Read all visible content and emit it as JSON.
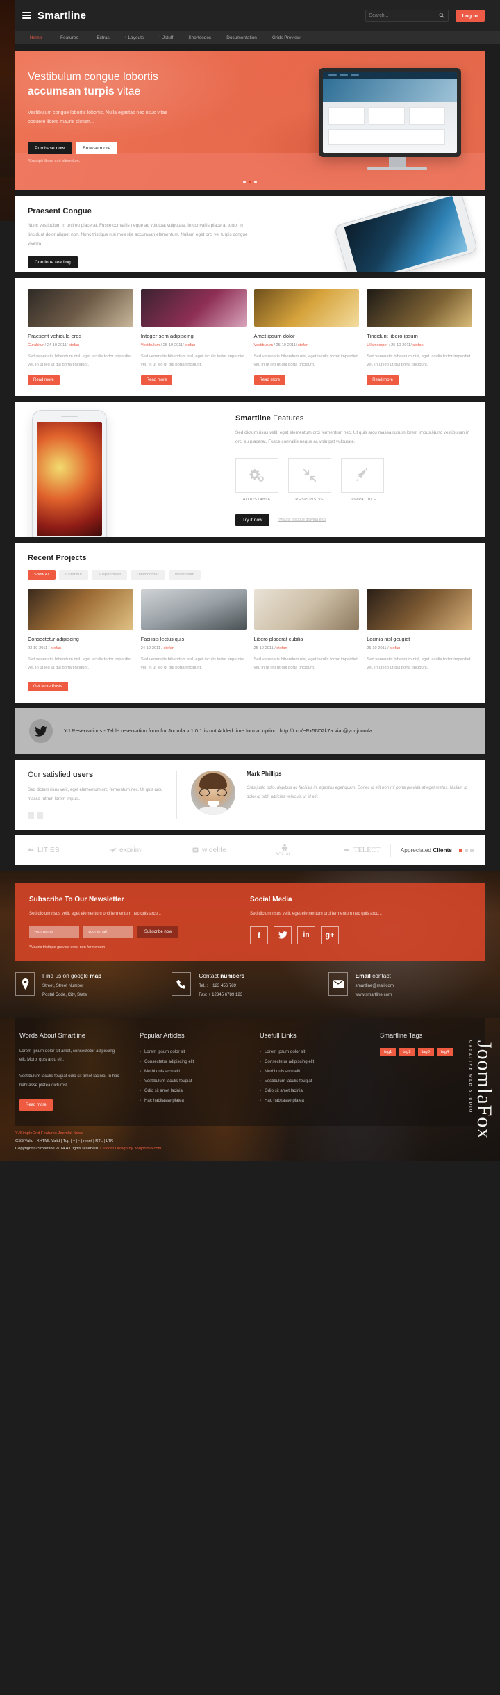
{
  "topbar": {
    "brand": "Smartline",
    "search_placeholder": "Search...",
    "login_label": "Log in"
  },
  "nav": {
    "items": [
      {
        "label": "Home",
        "caret": "",
        "active": true
      },
      {
        "label": "Features",
        "caret": "›",
        "active": false
      },
      {
        "label": "Extras",
        "caret": "›",
        "active": false
      },
      {
        "label": "Layouts",
        "caret": "›",
        "active": false
      },
      {
        "label": "Jstuff",
        "caret": "›",
        "active": false
      },
      {
        "label": "Shortcodes",
        "caret": "",
        "active": false
      },
      {
        "label": "Documentation",
        "caret": "",
        "active": false
      },
      {
        "label": "Grids Preview",
        "caret": "",
        "active": false
      }
    ]
  },
  "hero": {
    "title_line1": "Vestibulum congue lobortis",
    "title_bold": "accumsan turpis",
    "title_rest": " vitae",
    "body": "Vestibulum congue lobortis lobortis. Nulla egestas nec risus vitae posuere libero mauris dictum...",
    "btn_primary": "Purchase now",
    "btn_secondary": "Browse more",
    "note": "*Suscipit libero sed bibendum.",
    "slides": 3,
    "active_slide": 2
  },
  "congue": {
    "title": "Praesent Congue",
    "body": "Nunc vestibulum in orci eu placerat. Fusce convallis neque ac volutpat vulputate. In convallis placerat tortor in tincidunt dolor aliquet non. Nunc tristique nisi molestie accumsan elementum. Nullam eget orci vel turpis congue viverra",
    "button": "Continue reading"
  },
  "blog": {
    "read_more": "Read more",
    "excerpt": "Sed venenatis bibendum nisl, eget iaculis tortor imperdiet vel. In ut leo ut dui porta tincidunt.",
    "posts": [
      {
        "title": "Praesent vehicula eros",
        "category": "Curabitur",
        "date": "24-10-2011",
        "author": "stefan"
      },
      {
        "title": "Integer sem adipiscing",
        "category": "Vestibulum",
        "date": "25-10-2011",
        "author": "stefan"
      },
      {
        "title": "Amet ipsum dolor",
        "category": "Vestibulum",
        "date": "25-10-2011",
        "author": "stefan"
      },
      {
        "title": "Tincidunt libero ipsum",
        "category": "Ullamcorper",
        "date": "25-10-2011",
        "author": "stefan"
      }
    ]
  },
  "features": {
    "title_bold": "Smartline",
    "title_rest": " Features",
    "body": "Sed dictum risus velit, eget elementum orci fermentum nec. Ut quis arcu massa rutrum lorem impus.Nunc vestibulum in orci eu placerat. Fusce convallis neque ac volutpat vulputate.",
    "items": [
      {
        "icon": "gears-icon",
        "caption": "ADJUSTABLE"
      },
      {
        "icon": "resize-icon",
        "caption": "RESPONSIVE"
      },
      {
        "icon": "rocket-icon",
        "caption": "COMPATIBLE"
      }
    ],
    "button": "Try it now",
    "note": "*Mauris tristique gravida eros"
  },
  "projects": {
    "title": "Recent Projects",
    "filters": [
      {
        "label": "Show All",
        "active": true
      },
      {
        "label": "Curabitur",
        "active": false
      },
      {
        "label": "Suspendisse",
        "active": false
      },
      {
        "label": "Ullamcorper",
        "active": false
      },
      {
        "label": "Vestibulum",
        "active": false
      }
    ],
    "excerpt": "Sed venenatis bibendum nisl, eget iaculis tortor imperdiet vel. In ut leo ut dui porta tincidunt.",
    "button": "Get More Posts",
    "items": [
      {
        "title": "Consectetur adipiscing",
        "date": "23-10-2011",
        "author": "stefan"
      },
      {
        "title": "Facilisis lectus quis",
        "date": "24-10-2011",
        "author": "stefan"
      },
      {
        "title": "Libero placerat cubilia",
        "date": "25-10-2011",
        "author": "stefan"
      },
      {
        "title": "Lacinia nisl geugiat",
        "date": "25-10-2011",
        "author": "stefan"
      }
    ]
  },
  "twitter": {
    "text": "YJ Reservations - Table reservation form for Joomla v 1.0.1 is out Added time format option. http://t.co/eRx5N02k7a via @youjoomla"
  },
  "testimonial": {
    "heading_light": "Our satisfied ",
    "heading_bold": "users",
    "body": "Sed dictum risus velit, eget elementum orci fermentum nec. Ut quis arcu massa rutrum lorem impus...",
    "name": "Mark Phillips",
    "quote": "Cras justo odio, dapibus ac facilisis in, egestas eget quam. Donec id elit non mi porta gravida at eget metus. Nullam id dolor id nibh ultricies vehicula ut id elit.",
    "prev": "‹",
    "next": "›"
  },
  "clients": {
    "logos": [
      "LITIES",
      "exprimi",
      "widelife",
      "SOCIALL",
      "TELECT"
    ],
    "label_light": "Appreciated ",
    "label_bold": "Clients",
    "dots": 3,
    "active_dot": 0
  },
  "newsletter": {
    "title": "Subscribe To Our Newsletter",
    "body": "Sed dictum risus velit, eget elementum orci fermentum nec quis arcu...",
    "name_placeholder": "your name",
    "email_placeholder": "your email",
    "button": "Subscribe now",
    "note": "*Mauris tristique gravida eros, non fermentum"
  },
  "social": {
    "title": "Social Media",
    "body": "Sed dictum risus velit, eget elementum orci fermentum nec quis arcu...",
    "items": [
      {
        "name": "facebook-icon",
        "glyph": "f"
      },
      {
        "name": "twitter-icon",
        "glyph": "t"
      },
      {
        "name": "linkedin-icon",
        "glyph": "in"
      },
      {
        "name": "googleplus-icon",
        "glyph": "g+"
      }
    ]
  },
  "contacts": [
    {
      "icon": "map-pin-icon",
      "title_light": "Find us on google ",
      "title_bold": "map",
      "line1": "Street, Street Number",
      "line2": "Postal Code, City, State"
    },
    {
      "icon": "phone-icon",
      "title_light": "Contact ",
      "title_bold": "numbers",
      "line1": "Tel. : + 123 456 789",
      "line2": "Fax: + 12345 6789 123"
    },
    {
      "icon": "envelope-icon",
      "title_light": "",
      "title_bold": "Email",
      "title_tail": " contact",
      "line1": "smartline@mail.com",
      "line2": "www.smartline.com"
    }
  ],
  "footer": {
    "about": {
      "title": "Words About Smartline",
      "p1": "Lorem ipsum dolor sit amet, consectetur adipiscing elit. Morbi quis arcu elit.",
      "p2": "Vestibulum iaculis feugiat odio sit amet lacinia. In hac habitasse platea dictumst.",
      "button": "Read more"
    },
    "popular": {
      "title": "Popular Articles",
      "items": [
        "Lorem ipsum dolor sit",
        "Consectetur adipiscing elit",
        "Morbi quis arcu elit",
        "Vestibulum iaculis feugiat",
        "Odio sit amet lacinia",
        "Hac habitasse platea"
      ]
    },
    "useful": {
      "title": "Usefull Links",
      "items": [
        "Lorem ipsum dolor sit",
        "Consectetur adipiscing elit",
        "Morbi quis arcu elit",
        "Vestibulum iaculis feugiat",
        "Odio sit amet lacinia",
        "Hac habitasse platea"
      ]
    },
    "tags": {
      "title": "Smartline Tags",
      "items": [
        "tag1",
        "tag2",
        "tag3",
        "tag4"
      ]
    }
  },
  "bottom": {
    "line1": "YJSimpleGrid Features   Joomla! News",
    "line2": "CSS Valid | XHTML Valid | Top | + | - | reset | RTL | LTR",
    "line3_plain": "Copyright © Smartline 2014 All rights reserved. ",
    "line3_link": "Custom Design by Youjoomla.com"
  },
  "watermark": {
    "text": "JoomlaFox",
    "sub": "CREATIVE WEB STUDIO"
  },
  "colors": {
    "accent": "#ef5b41",
    "hero": "#e8644a",
    "dark": "#232323",
    "nav": "#2e2e2e"
  }
}
